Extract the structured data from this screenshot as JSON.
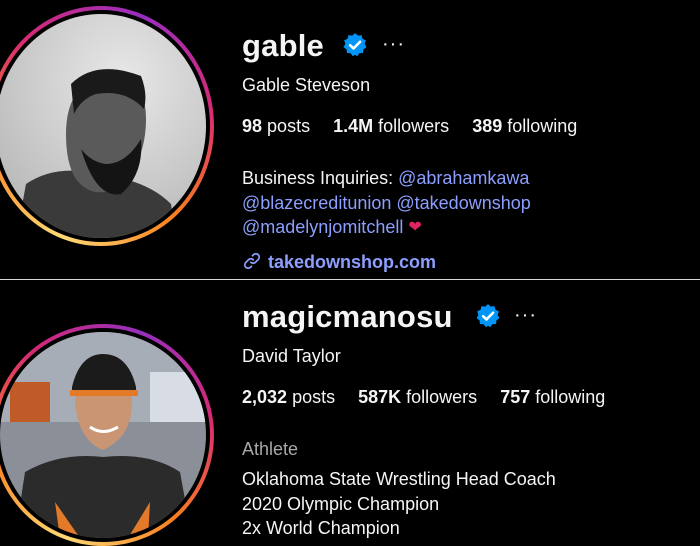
{
  "profiles": [
    {
      "username": "gable",
      "full_name": "Gable Steveson",
      "stats": {
        "posts_value": "98",
        "posts_label": "posts",
        "followers_value": "1.4M",
        "followers_label": "followers",
        "following_value": "389",
        "following_label": "following"
      },
      "bio": {
        "prefix": "Business Inquiries:",
        "mentions": [
          "@abrahamkawa",
          "@blazecreditunion",
          "@takedownshop",
          "@madelynjomitchell"
        ]
      },
      "link": "takedownshop.com"
    },
    {
      "username": "magicmanosu",
      "full_name": "David Taylor",
      "stats": {
        "posts_value": "2,032",
        "posts_label": "posts",
        "followers_value": "587K",
        "followers_label": "followers",
        "following_value": "757",
        "following_label": "following"
      },
      "category": "Athlete",
      "bio_lines": [
        "Oklahoma State Wrestling Head Coach",
        "2020 Olympic Champion",
        "2x World Champion"
      ]
    }
  ],
  "icons": {
    "verified": "verified-badge-icon",
    "more": "more-options-icon",
    "link": "link-chain-icon",
    "heart": "heart-emoji-icon"
  },
  "colors": {
    "background": "#000000",
    "text": "#f5f5f5",
    "mention": "#8c9fff",
    "verified": "#0095f6",
    "muted": "#a8a8a8"
  },
  "glyphs": {
    "more": "···",
    "heart": "❤"
  }
}
